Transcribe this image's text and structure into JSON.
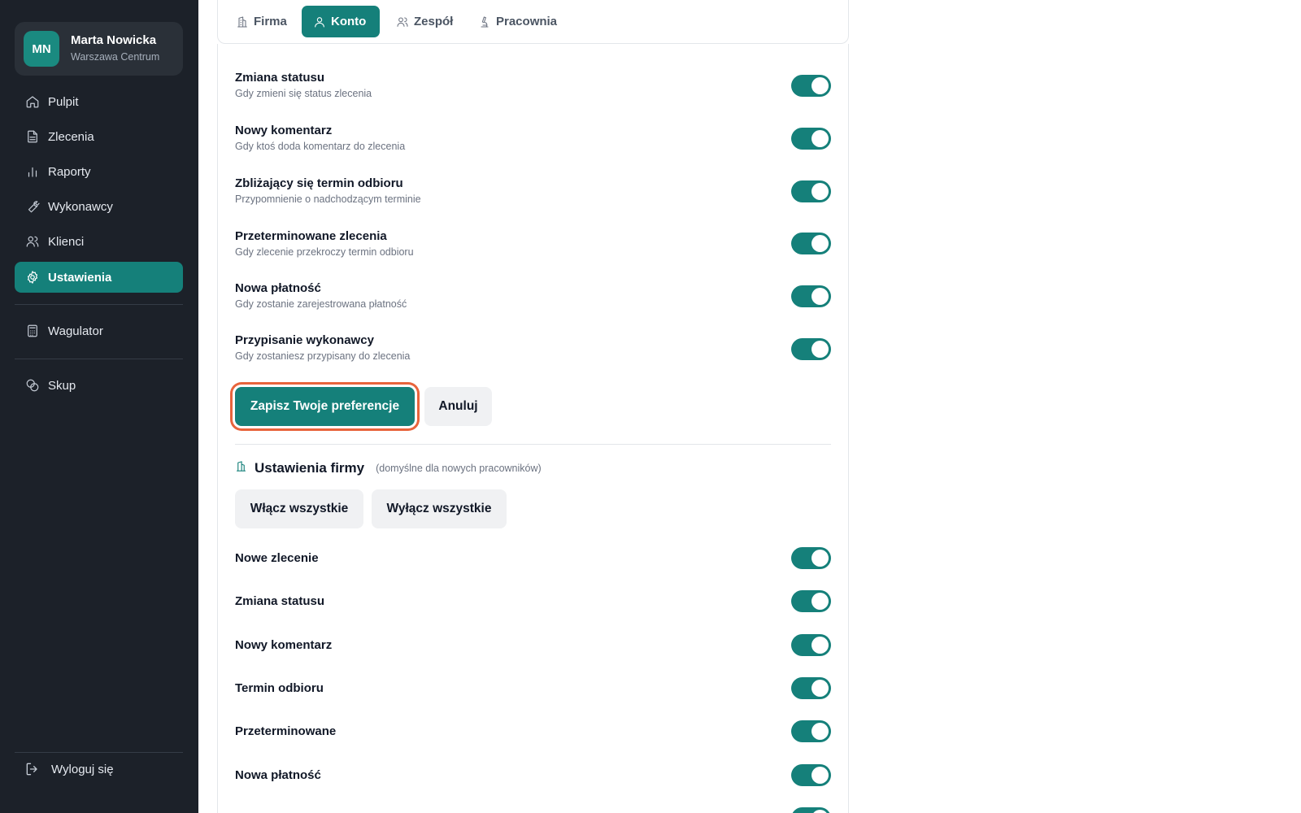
{
  "profile": {
    "initials": "MN",
    "name": "Marta Nowicka",
    "location": "Warszawa Centrum"
  },
  "sidebar": {
    "items": [
      {
        "label": "Pulpit",
        "icon": "home-icon"
      },
      {
        "label": "Zlecenia",
        "icon": "document-icon"
      },
      {
        "label": "Raporty",
        "icon": "bar-chart-icon"
      },
      {
        "label": "Wykonawcy",
        "icon": "wrench-icon"
      },
      {
        "label": "Klienci",
        "icon": "users-icon"
      },
      {
        "label": "Ustawienia",
        "icon": "gear-icon",
        "active": true
      },
      {
        "label": "Wagulator",
        "icon": "calculator-icon"
      },
      {
        "label": "Skup",
        "icon": "coins-icon"
      }
    ],
    "logout_label": "Wyloguj się"
  },
  "tabs": [
    {
      "label": "Firma",
      "icon": "building-icon"
    },
    {
      "label": "Konto",
      "icon": "user-icon",
      "active": true
    },
    {
      "label": "Zespół",
      "icon": "users-icon"
    },
    {
      "label": "Pracownia",
      "icon": "microscope-icon"
    }
  ],
  "personal_settings": [
    {
      "title": "Zmiana statusu",
      "desc": "Gdy zmieni się status zlecenia",
      "enabled": true
    },
    {
      "title": "Nowy komentarz",
      "desc": "Gdy ktoś doda komentarz do zlecenia",
      "enabled": true
    },
    {
      "title": "Zbliżający się termin odbioru",
      "desc": "Przypomnienie o nadchodzącym terminie",
      "enabled": true
    },
    {
      "title": "Przeterminowane zlecenia",
      "desc": "Gdy zlecenie przekroczy termin odbioru",
      "enabled": true
    },
    {
      "title": "Nowa płatność",
      "desc": "Gdy zostanie zarejestrowana płatność",
      "enabled": true
    },
    {
      "title": "Przypisanie wykonawcy",
      "desc": "Gdy zostaniesz przypisany do zlecenia",
      "enabled": true
    }
  ],
  "actions": {
    "save_label": "Zapisz Twoje preferencje",
    "cancel_label": "Anuluj"
  },
  "company_section": {
    "title": "Ustawienia firmy",
    "subtitle": "(domyślne dla nowych pracowników)",
    "enable_all_label": "Włącz wszystkie",
    "disable_all_label": "Wyłącz wszystkie",
    "rows": [
      {
        "title": "Nowe zlecenie",
        "enabled": true
      },
      {
        "title": "Zmiana statusu",
        "enabled": true
      },
      {
        "title": "Nowy komentarz",
        "enabled": true
      },
      {
        "title": "Termin odbioru",
        "enabled": true
      },
      {
        "title": "Przeterminowane",
        "enabled": true
      },
      {
        "title": "Nowa płatność",
        "enabled": true
      }
    ]
  },
  "colors": {
    "accent": "#15807a",
    "sidebar_bg": "#1c2129",
    "focus_ring": "#e8643c"
  }
}
